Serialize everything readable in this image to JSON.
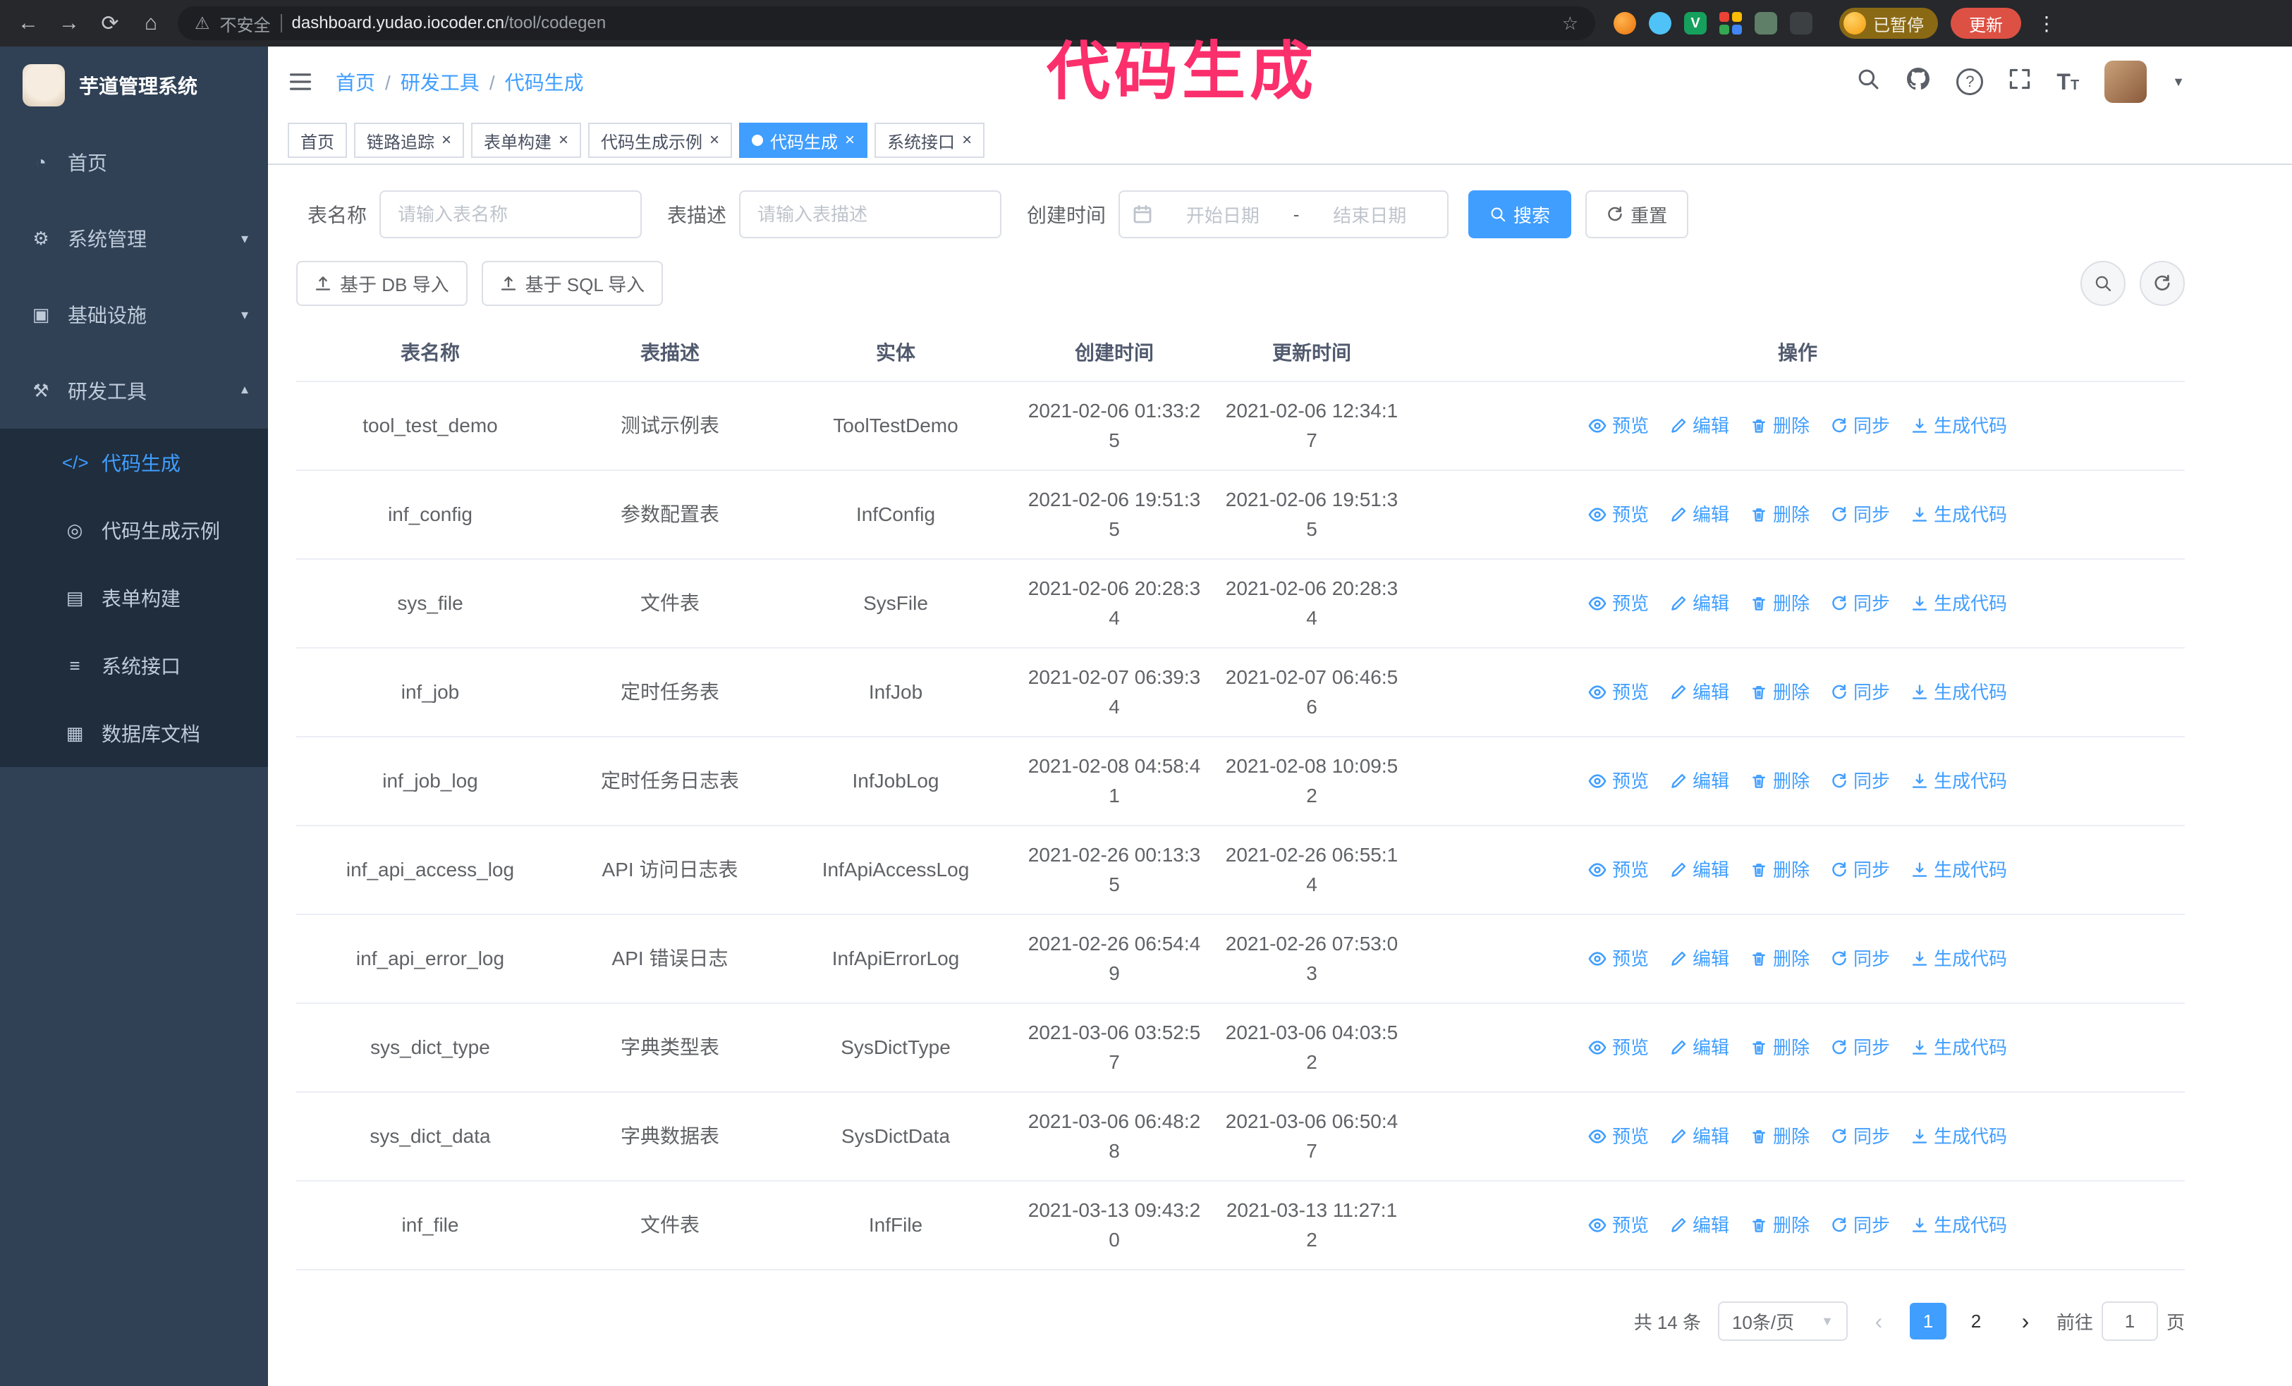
{
  "colors": {
    "accent": "#409eff",
    "sidebar-bg": "#304156",
    "submenu-bg": "#1f2d3d",
    "chrome-bg": "#26282b",
    "annotation": "#fb2f6c",
    "update-red": "#dd5144",
    "paused-gold": "#8a6914",
    "border": "#dcdfe6",
    "table-border": "#ebeef5",
    "text": "#606266",
    "heading": "#515a6e",
    "placeholder": "#bfc4cc",
    "menu-text": "#bfcbd9"
  },
  "annotation": {
    "text": "代码生成"
  },
  "browser": {
    "security_label": "不安全",
    "url_host": "dashboard.yudao.iocoder.cn",
    "url_path": "/tool/codegen",
    "paused_badge": "已暂停",
    "update_button": "更新",
    "extension_icons": [
      "fox-icon",
      "drop-icon",
      "vue-devtools-icon",
      "grid-icon",
      "green-box-icon",
      "puzzle-icon"
    ]
  },
  "icons": {
    "dashboard": "◔",
    "system": "⚙",
    "infra": "▣",
    "devtools": "⚒",
    "codegen": "</>",
    "codegen_demo": "◎",
    "form_builder": "▤",
    "api": "≡",
    "db_doc": "▦"
  },
  "sidebar": {
    "logo_title": "芋道管理系统",
    "items": [
      {
        "label": "首页"
      },
      {
        "label": "系统管理"
      },
      {
        "label": "基础设施"
      },
      {
        "label": "研发工具"
      }
    ],
    "subitems": [
      {
        "label": "代码生成"
      },
      {
        "label": "代码生成示例"
      },
      {
        "label": "表单构建"
      },
      {
        "label": "系统接口"
      },
      {
        "label": "数据库文档"
      }
    ]
  },
  "header": {
    "breadcrumb": [
      {
        "label": "首页"
      },
      {
        "label": "研发工具"
      },
      {
        "label": "代码生成"
      }
    ],
    "breadcrumb_separator": "/"
  },
  "tabs": [
    {
      "label": "首页"
    },
    {
      "label": "链路追踪"
    },
    {
      "label": "表单构建"
    },
    {
      "label": "代码生成示例"
    },
    {
      "label": "代码生成"
    },
    {
      "label": "系统接口"
    }
  ],
  "filters": {
    "table_name_label": "表名称",
    "table_name_placeholder": "请输入表名称",
    "table_desc_label": "表描述",
    "table_desc_placeholder": "请输入表描述",
    "create_time_label": "创建时间",
    "date_start_placeholder": "开始日期",
    "date_separator": "-",
    "date_end_placeholder": "结束日期",
    "search_button": "搜索",
    "reset_button": "重置"
  },
  "toolbar": {
    "import_db": "基于 DB 导入",
    "import_sql": "基于 SQL 导入"
  },
  "table": {
    "columns": [
      "表名称",
      "表描述",
      "实体",
      "创建时间",
      "更新时间",
      "操作"
    ],
    "actions": [
      "预览",
      "编辑",
      "删除",
      "同步",
      "生成代码"
    ],
    "rows": [
      {
        "name": "tool_test_demo",
        "desc": "测试示例表",
        "entity": "ToolTestDemo",
        "created": "2021-02-06 01:33:25",
        "updated": "2021-02-06 12:34:17"
      },
      {
        "name": "inf_config",
        "desc": "参数配置表",
        "entity": "InfConfig",
        "created": "2021-02-06 19:51:35",
        "updated": "2021-02-06 19:51:35"
      },
      {
        "name": "sys_file",
        "desc": "文件表",
        "entity": "SysFile",
        "created": "2021-02-06 20:28:34",
        "updated": "2021-02-06 20:28:34"
      },
      {
        "name": "inf_job",
        "desc": "定时任务表",
        "entity": "InfJob",
        "created": "2021-02-07 06:39:34",
        "updated": "2021-02-07 06:46:56"
      },
      {
        "name": "inf_job_log",
        "desc": "定时任务日志表",
        "entity": "InfJobLog",
        "created": "2021-02-08 04:58:41",
        "updated": "2021-02-08 10:09:52"
      },
      {
        "name": "inf_api_access_log",
        "desc": "API 访问日志表",
        "entity": "InfApiAccessLog",
        "created": "2021-02-26 00:13:35",
        "updated": "2021-02-26 06:55:14"
      },
      {
        "name": "inf_api_error_log",
        "desc": "API 错误日志",
        "entity": "InfApiErrorLog",
        "created": "2021-02-26 06:54:49",
        "updated": "2021-02-26 07:53:03"
      },
      {
        "name": "sys_dict_type",
        "desc": "字典类型表",
        "entity": "SysDictType",
        "created": "2021-03-06 03:52:57",
        "updated": "2021-03-06 04:03:52"
      },
      {
        "name": "sys_dict_data",
        "desc": "字典数据表",
        "entity": "SysDictData",
        "created": "2021-03-06 06:48:28",
        "updated": "2021-03-06 06:50:47"
      },
      {
        "name": "inf_file",
        "desc": "文件表",
        "entity": "InfFile",
        "created": "2021-03-13 09:43:20",
        "updated": "2021-03-13 11:27:12"
      }
    ]
  },
  "pagination": {
    "total": "共 14 条",
    "page_size": "10条/页",
    "pages": [
      "1",
      "2"
    ],
    "goto_label": "前往",
    "goto_value": "1",
    "goto_suffix": "页"
  }
}
